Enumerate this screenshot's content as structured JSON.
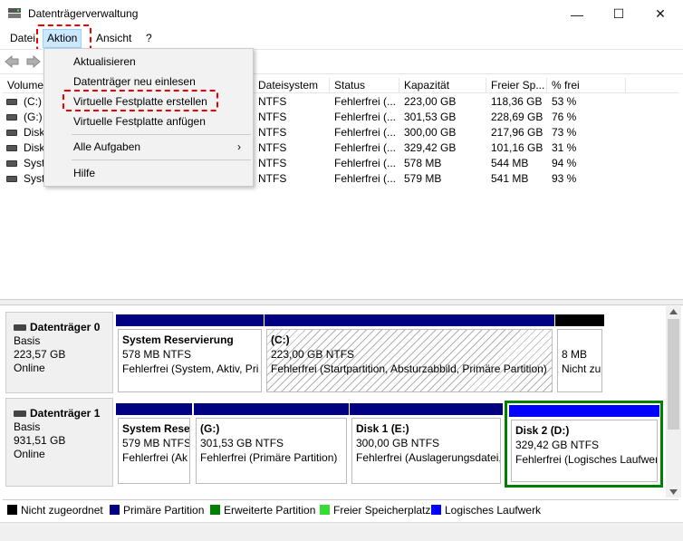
{
  "window": {
    "title": "Datenträgerverwaltung",
    "minimize": "—",
    "maximize": "☐",
    "close": "✕"
  },
  "menubar": {
    "file": "Datei",
    "action": "Aktion",
    "view": "Ansicht",
    "help": "?"
  },
  "action_menu": {
    "items": [
      "Aktualisieren",
      "Datenträger neu einlesen",
      "Virtuelle Festplatte erstellen",
      "Virtuelle Festplatte anfügen",
      "Alle Aufgaben",
      "Hilfe"
    ],
    "submenu_arrow": "›"
  },
  "volume_list": {
    "columns": [
      "Volume",
      "Dateisystem",
      "Status",
      "Kapazität",
      "Freier Sp...",
      "% frei"
    ],
    "rows": [
      {
        "volume": "(C:)",
        "fs": "NTFS",
        "status": "Fehlerfrei (...",
        "capacity": "223,00 GB",
        "free": "118,36 GB",
        "pct": "53 %"
      },
      {
        "volume": "(G:)",
        "fs": "NTFS",
        "status": "Fehlerfrei (...",
        "capacity": "301,53 GB",
        "free": "228,69 GB",
        "pct": "76 %"
      },
      {
        "volume": "Disk",
        "fs": "NTFS",
        "status": "Fehlerfrei (...",
        "capacity": "300,00 GB",
        "free": "217,96 GB",
        "pct": "73 %"
      },
      {
        "volume": "Disk",
        "fs": "NTFS",
        "status": "Fehlerfrei (...",
        "capacity": "329,42 GB",
        "free": "101,16 GB",
        "pct": "31 %"
      },
      {
        "volume": "Syste",
        "fs": "NTFS",
        "status": "Fehlerfrei (...",
        "capacity": "578 MB",
        "free": "544 MB",
        "pct": "94 %"
      },
      {
        "volume": "Syste",
        "fs": "NTFS",
        "status": "Fehlerfrei (...",
        "capacity": "579 MB",
        "free": "541 MB",
        "pct": "93 %"
      }
    ]
  },
  "disks": [
    {
      "name": "Datenträger 0",
      "type": "Basis",
      "size": "223,57 GB",
      "state": "Online",
      "partitions": [
        {
          "name": "System Reservierung",
          "size": "578 MB NTFS",
          "status": "Fehlerfrei (System, Aktiv, Pri"
        },
        {
          "name": "(C:)",
          "size": "223,00 GB NTFS",
          "status": "Fehlerfrei (Startpartition, Absturzabbild, Primäre Partition)"
        },
        {
          "name": "",
          "size": "8 MB",
          "status": "Nicht zu"
        }
      ]
    },
    {
      "name": "Datenträger 1",
      "type": "Basis",
      "size": "931,51 GB",
      "state": "Online",
      "partitions": [
        {
          "name": "System Rese",
          "size": "579 MB NTFS",
          "status": "Fehlerfrei (Ak"
        },
        {
          "name": "(G:)",
          "size": "301,53 GB NTFS",
          "status": "Fehlerfrei (Primäre Partition)"
        },
        {
          "name": "Disk 1  (E:)",
          "size": "300,00 GB NTFS",
          "status": "Fehlerfrei (Auslagerungsdatei,"
        },
        {
          "name": "Disk 2  (D:)",
          "size": "329,42 GB NTFS",
          "status": "Fehlerfrei (Logisches Laufwer"
        }
      ]
    }
  ],
  "legend": [
    {
      "label": "Nicht zugeordnet",
      "color": "#000000"
    },
    {
      "label": "Primäre Partition",
      "color": "#000080"
    },
    {
      "label": "Erweiterte Partition",
      "color": "#008000"
    },
    {
      "label": "Freier Speicherplatz",
      "color": "#33dd33"
    },
    {
      "label": "Logisches Laufwerk",
      "color": "#0000ff"
    }
  ],
  "colors": {
    "primary_bar": "#000080",
    "unallocated_bar": "#000000",
    "logical_bar": "#0000ff",
    "extended_border": "#008000",
    "highlight_dash": "#e00000"
  }
}
